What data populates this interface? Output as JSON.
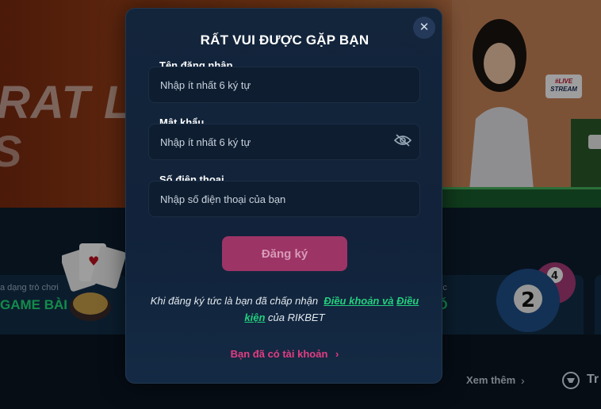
{
  "background": {
    "banner_text": "RAT LIV",
    "banner_text_2": "S",
    "live_badge_top": "#LIVE",
    "live_badge_bottom": "STREAM",
    "card_left": {
      "subtitle": "a dạng trò chơi",
      "title": "GAME BÀI"
    },
    "card_right": {
      "subtitle": "n tốc",
      "title": "SỐ"
    },
    "see_more": "Xem thêm",
    "partial_text": "Tr"
  },
  "modal": {
    "title": "RẤT VUI ĐƯỢC GẶP BẠN",
    "username": {
      "label": "Tên đăng nhập",
      "placeholder": "Nhập ít nhất 6 ký tự"
    },
    "password": {
      "label": "Mật khẩu",
      "placeholder": "Nhập ít nhất 6 ký tự"
    },
    "phone": {
      "label": "Số điện thoại",
      "placeholder": "Nhập số điện thoại của bạn"
    },
    "submit_label": "Đăng ký",
    "terms": {
      "prefix": "Khi đăng ký tức là bạn đã chấp nhận",
      "link1": "Điều khoản và",
      "link2": "Điều kiện",
      "suffix": "của RIKBET"
    },
    "login_link": "Bạn đã có tài khoản"
  },
  "colors": {
    "accent": "#9c3466",
    "link_green": "#23d07e",
    "link_pink": "#e23d82",
    "modal_bg": "#13253b"
  }
}
